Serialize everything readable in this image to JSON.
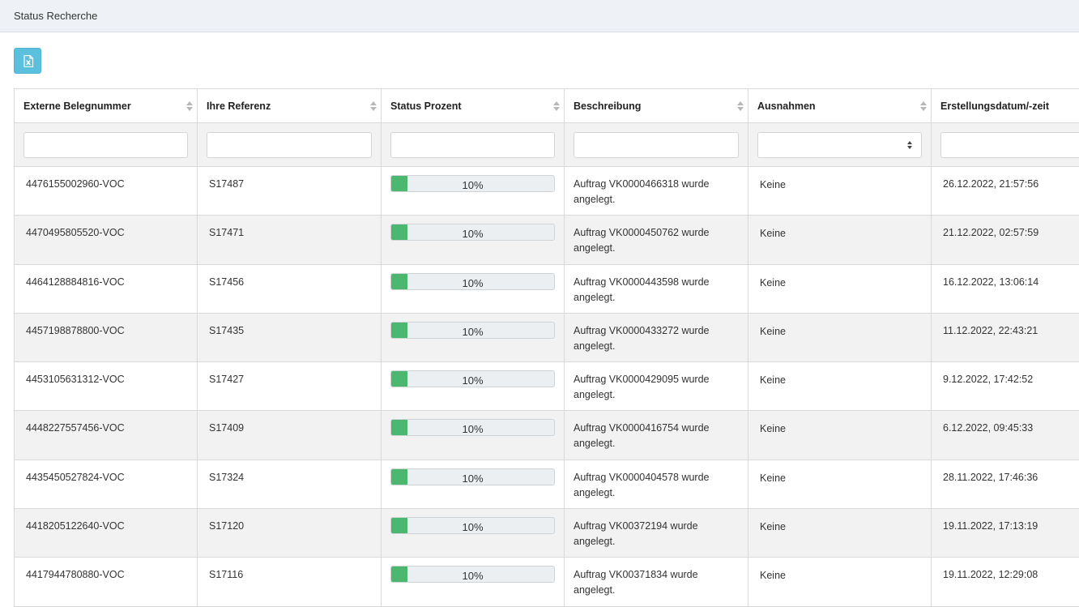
{
  "header": {
    "title": "Status Recherche"
  },
  "toolbar": {
    "export_icon": "excel-export-icon"
  },
  "table": {
    "columns": [
      "Externe Belegnummer",
      "Ihre Referenz",
      "Status Prozent",
      "Beschreibung",
      "Ausnahmen",
      "Erstellungsdatum/-zeit"
    ],
    "filters": {
      "values": [
        "",
        "",
        "",
        "",
        "",
        ""
      ]
    },
    "rows": [
      {
        "externe": "4476155002960-VOC",
        "referenz": "S17487",
        "progress": 0.1,
        "progress_label": "10%",
        "desc_line1": "Auftrag VK0000466318 wurde",
        "desc_line2": "angelegt.",
        "ausnahmen": "Keine",
        "datum": "26.12.2022, 21:57:56"
      },
      {
        "externe": "4470495805520-VOC",
        "referenz": "S17471",
        "progress": 0.1,
        "progress_label": "10%",
        "desc_line1": "Auftrag VK0000450762 wurde",
        "desc_line2": "angelegt.",
        "ausnahmen": "Keine",
        "datum": "21.12.2022, 02:57:59"
      },
      {
        "externe": "4464128884816-VOC",
        "referenz": "S17456",
        "progress": 0.1,
        "progress_label": "10%",
        "desc_line1": "Auftrag VK0000443598 wurde",
        "desc_line2": "angelegt.",
        "ausnahmen": "Keine",
        "datum": "16.12.2022, 13:06:14"
      },
      {
        "externe": "4457198878800-VOC",
        "referenz": "S17435",
        "progress": 0.1,
        "progress_label": "10%",
        "desc_line1": "Auftrag VK0000433272 wurde",
        "desc_line2": "angelegt.",
        "ausnahmen": "Keine",
        "datum": "11.12.2022, 22:43:21"
      },
      {
        "externe": "4453105631312-VOC",
        "referenz": "S17427",
        "progress": 0.1,
        "progress_label": "10%",
        "desc_line1": "Auftrag VK0000429095 wurde",
        "desc_line2": "angelegt.",
        "ausnahmen": "Keine",
        "datum": "9.12.2022, 17:42:52"
      },
      {
        "externe": "4448227557456-VOC",
        "referenz": "S17409",
        "progress": 0.1,
        "progress_label": "10%",
        "desc_line1": "Auftrag VK0000416754 wurde",
        "desc_line2": "angelegt.",
        "ausnahmen": "Keine",
        "datum": "6.12.2022, 09:45:33"
      },
      {
        "externe": "4435450527824-VOC",
        "referenz": "S17324",
        "progress": 0.1,
        "progress_label": "10%",
        "desc_line1": "Auftrag VK0000404578 wurde",
        "desc_line2": "angelegt.",
        "ausnahmen": "Keine",
        "datum": "28.11.2022, 17:46:36"
      },
      {
        "externe": "4418205122640-VOC",
        "referenz": "S17120",
        "progress": 0.1,
        "progress_label": "10%",
        "desc_line1": "Auftrag VK00372194 wurde",
        "desc_line2": "angelegt.",
        "ausnahmen": "Keine",
        "datum": "19.11.2022, 17:13:19"
      },
      {
        "externe": "4417944780880-VOC",
        "referenz": "S17116",
        "progress": 0.1,
        "progress_label": "10%",
        "desc_line1": "Auftrag VK00371834 wurde",
        "desc_line2": "angelegt.",
        "ausnahmen": "Keine",
        "datum": "19.11.2022, 12:29:08"
      }
    ]
  },
  "colors": {
    "header_bg": "#eef2f6",
    "export_button": "#5bc0de",
    "progress_fill": "#4cb86f",
    "progress_track": "#eceff2",
    "stripe": "#f2f2f2"
  }
}
